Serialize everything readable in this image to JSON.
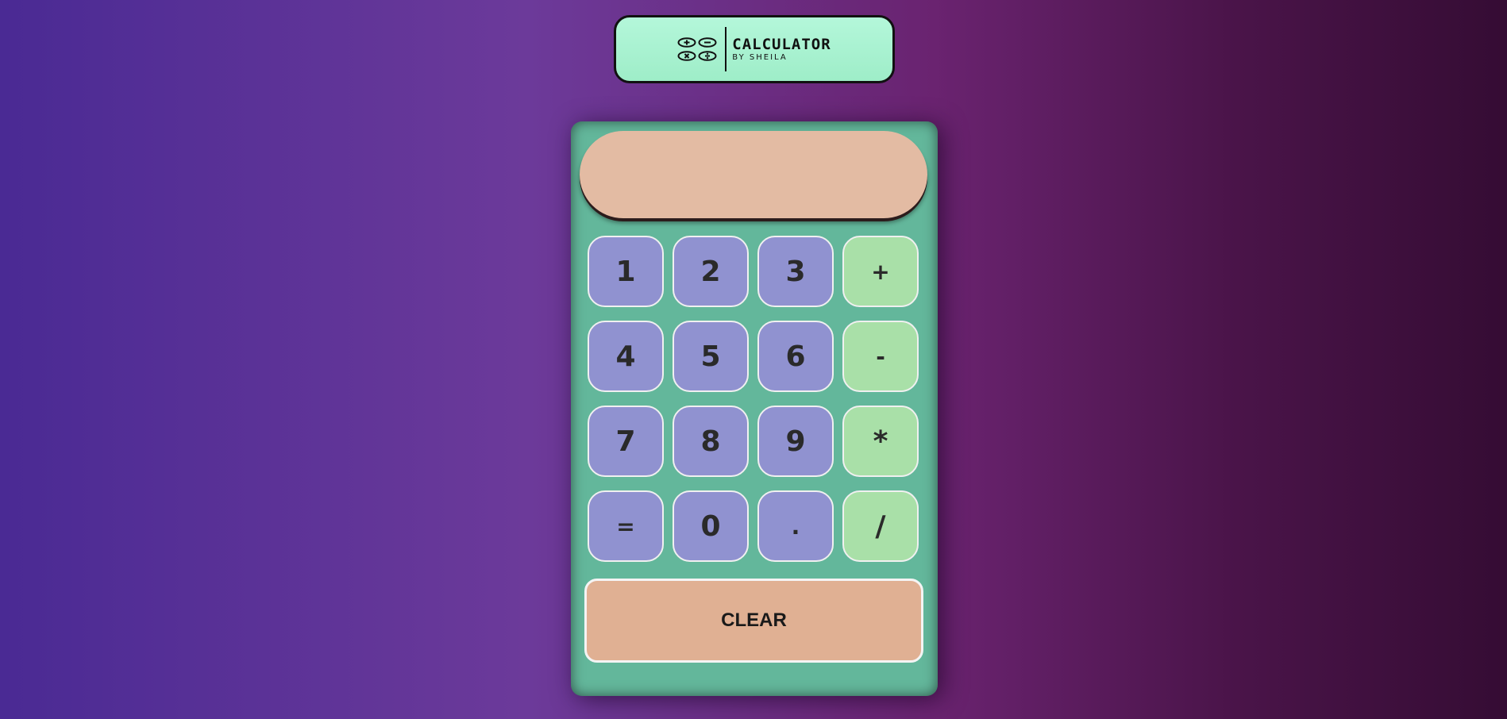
{
  "logo": {
    "title": "CALCULATOR",
    "subtitle": "BY SHEILA"
  },
  "display": {
    "value": ""
  },
  "keys": [
    {
      "label": "1",
      "kind": "digit"
    },
    {
      "label": "2",
      "kind": "digit"
    },
    {
      "label": "3",
      "kind": "digit"
    },
    {
      "label": "+",
      "kind": "operator"
    },
    {
      "label": "4",
      "kind": "digit"
    },
    {
      "label": "5",
      "kind": "digit"
    },
    {
      "label": "6",
      "kind": "digit"
    },
    {
      "label": "-",
      "kind": "operator"
    },
    {
      "label": "7",
      "kind": "digit"
    },
    {
      "label": "8",
      "kind": "digit"
    },
    {
      "label": "9",
      "kind": "digit"
    },
    {
      "label": "*",
      "kind": "operator"
    },
    {
      "label": "=",
      "kind": "digit"
    },
    {
      "label": "0",
      "kind": "digit"
    },
    {
      "label": ".",
      "kind": "digit"
    },
    {
      "label": "/",
      "kind": "operator"
    }
  ],
  "clear": {
    "label": "CLEAR"
  },
  "colors": {
    "calculator_body": "#63b79b",
    "display": "#e3bba3",
    "digit_key": "#9092d0",
    "operator_key": "#a9e0a8",
    "clear_key": "#e0b093",
    "logo_background": "#b4f7da"
  },
  "icons": [
    "plus-circle-icon",
    "minus-circle-icon",
    "times-circle-icon",
    "divide-circle-icon"
  ]
}
